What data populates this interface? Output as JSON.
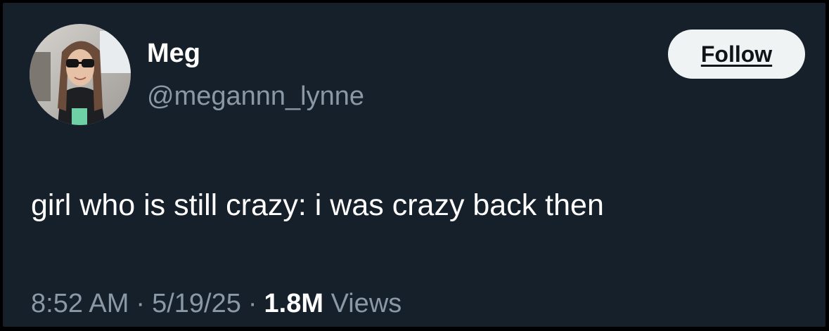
{
  "user": {
    "display_name": "Meg",
    "handle": "@megannn_lynne"
  },
  "follow_button": {
    "label": "Follow"
  },
  "tweet": {
    "text": "girl who is still crazy: i was crazy back then"
  },
  "meta": {
    "time": "8:52 AM",
    "date": "5/19/25",
    "separator": "·",
    "views_count": "1.8M",
    "views_label": "Views"
  },
  "colors": {
    "background": "#15202b",
    "primary_text": "#ffffff",
    "secondary_text": "#8b98a5",
    "button_bg": "#eff3f4",
    "button_text": "#0f1419"
  }
}
